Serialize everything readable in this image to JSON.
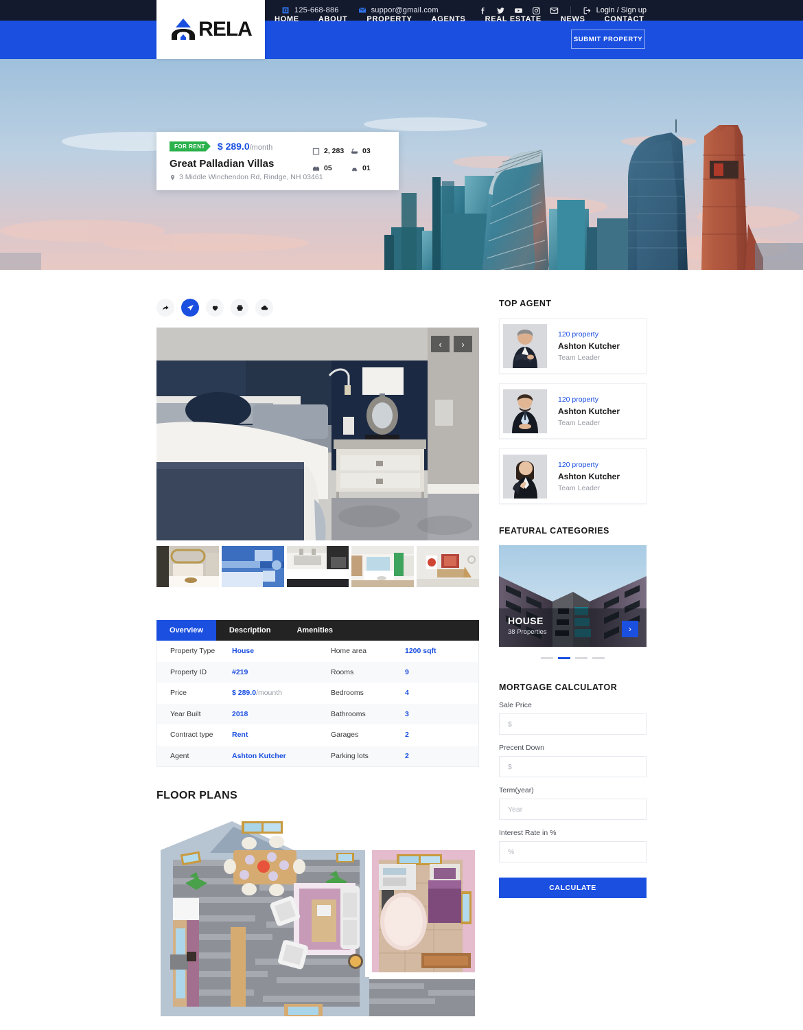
{
  "topbar": {
    "phone": "125-668-886",
    "email": "suppor@gmail.com",
    "login_label": "Login / Sign up",
    "socials": [
      "facebook-icon",
      "twitter-icon",
      "youtube-icon",
      "instagram-icon",
      "envelope-icon"
    ]
  },
  "brand": {
    "name": "RELA"
  },
  "nav": {
    "links": [
      {
        "label": "HOME"
      },
      {
        "label": "ABOUT"
      },
      {
        "label": "PROPERTY"
      },
      {
        "label": "AGENTS"
      },
      {
        "label": "REAL ESTATE"
      },
      {
        "label": "NEWS"
      },
      {
        "label": "CONTACT"
      }
    ],
    "submit_label": "SUBMIT PROPERTY"
  },
  "hero_card": {
    "badge": "FOR RENT",
    "price": "$ 289.0",
    "price_unit": "/month",
    "title": "Great Palladian Villas",
    "address": "3 Middle Winchendon Rd, Rindge, NH 03461",
    "stats": [
      {
        "icon": "area-icon",
        "value": "2, 283"
      },
      {
        "icon": "bath-icon",
        "value": "03"
      },
      {
        "icon": "bed-icon",
        "value": "05"
      },
      {
        "icon": "car-icon",
        "value": "01"
      }
    ]
  },
  "actions": [
    {
      "icon": "share-icon",
      "active": false
    },
    {
      "icon": "send-icon",
      "active": true
    },
    {
      "icon": "heart-icon",
      "active": false
    },
    {
      "icon": "print-icon",
      "active": false
    },
    {
      "icon": "cloud-download-icon",
      "active": false
    }
  ],
  "gallery": {
    "prev_label": "‹",
    "next_label": "›",
    "thumbs": [
      "bedroom-beige",
      "bedroom-blue",
      "kitchen-dark",
      "living-white",
      "lounge-red"
    ]
  },
  "tabs": [
    {
      "label": "Overview",
      "active": true
    },
    {
      "label": "Description",
      "active": false
    },
    {
      "label": "Amenities",
      "active": false
    }
  ],
  "overview": {
    "left": [
      {
        "key": "Property Type",
        "value": "House",
        "suffix": ""
      },
      {
        "key": "Property ID",
        "value": "#219",
        "suffix": ""
      },
      {
        "key": "Price",
        "value": "$ 289.0",
        "suffix": "/mounth"
      },
      {
        "key": "Year Built",
        "value": "2018",
        "suffix": ""
      },
      {
        "key": "Contract type",
        "value": "Rent",
        "suffix": ""
      },
      {
        "key": "Agent",
        "value": "Ashton Kutcher",
        "suffix": ""
      }
    ],
    "right": [
      {
        "key": "Home area",
        "value": "1200 sqft",
        "suffix": ""
      },
      {
        "key": "Rooms",
        "value": "9",
        "suffix": ""
      },
      {
        "key": "Bedrooms",
        "value": "4",
        "suffix": ""
      },
      {
        "key": "Bathrooms",
        "value": "3",
        "suffix": ""
      },
      {
        "key": "Garages",
        "value": "2",
        "suffix": ""
      },
      {
        "key": "Parking lots",
        "value": "2",
        "suffix": ""
      }
    ]
  },
  "floor_plans": {
    "title": "FLOOR PLANS"
  },
  "sidebar": {
    "top_agent": {
      "title": "TOP AGENT",
      "agents": [
        {
          "count": "120 property",
          "name": "Ashton Kutcher",
          "role": "Team Leader",
          "photo": "man-arms-crossed"
        },
        {
          "count": "120 property",
          "name": "Ashton Kutcher",
          "role": "Team Leader",
          "photo": "man-hands-clasped"
        },
        {
          "count": "120 property",
          "name": "Ashton Kutcher",
          "role": "Team Leader",
          "photo": "woman-thinking"
        }
      ]
    },
    "categories": {
      "title": "FEATURAL CATEGORIES",
      "card": {
        "name": "HOUSE",
        "count": "38 Properties",
        "arrow": "›"
      },
      "dots": [
        false,
        true,
        false,
        false
      ]
    },
    "mortgage": {
      "title": "MORTGAGE CALCULATOR",
      "fields": [
        {
          "label": "Sale Price",
          "placeholder": "$",
          "value": ""
        },
        {
          "label": "Precent Down",
          "placeholder": "$",
          "value": ""
        },
        {
          "label": "Term(year)",
          "placeholder": "Year",
          "value": ""
        },
        {
          "label": "Interest Rate in %",
          "placeholder": "%",
          "value": ""
        }
      ],
      "button_label": "CALCULATE"
    }
  },
  "colors": {
    "brand_blue": "#1a4fe0",
    "dark_navy": "#141a2e",
    "tab_dark": "#232323",
    "green_badge": "#2bb24c",
    "muted_text": "#9a9da6"
  }
}
